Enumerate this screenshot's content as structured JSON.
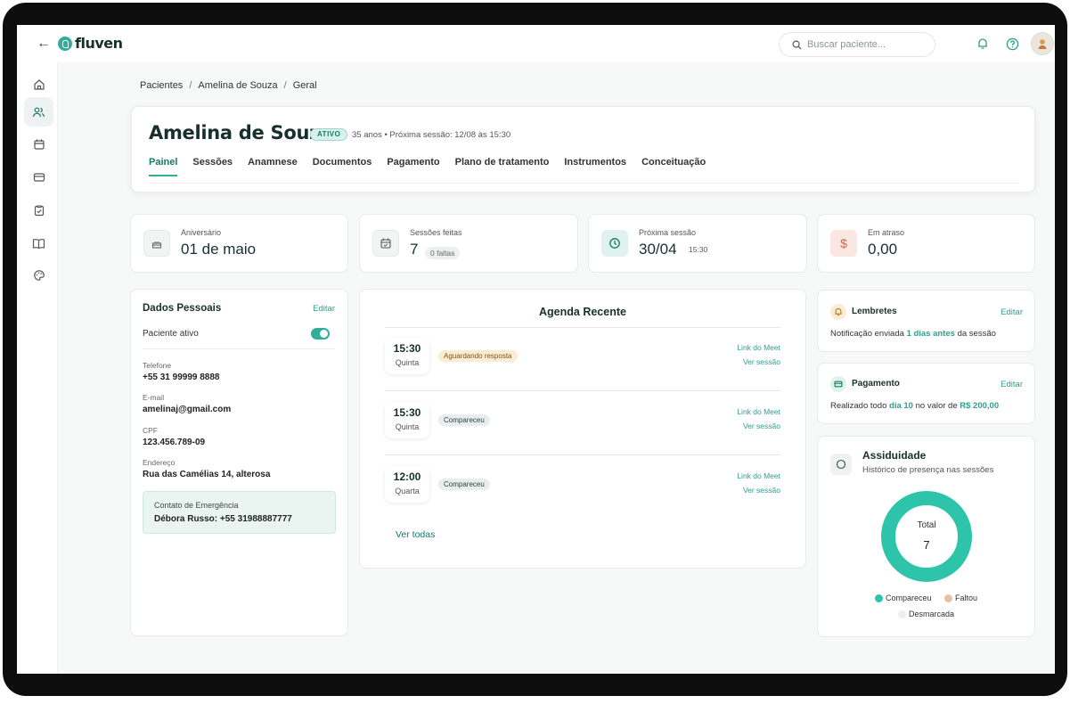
{
  "app": {
    "name": "fluven"
  },
  "search": {
    "placeholder": "Buscar paciente..."
  },
  "breadcrumb": [
    "Pacientes",
    "Amelina de Souza",
    "Geral"
  ],
  "patient": {
    "name": "Amelina de Souza",
    "status": "ATIVO",
    "meta": "35 anos • Próxima sessão: 12/08 às 15:30"
  },
  "tabs": [
    "Painel",
    "Sessões",
    "Anamnese",
    "Documentos",
    "Pagamento",
    "Plano de tratamento",
    "Instrumentos",
    "Conceituação"
  ],
  "stats": {
    "birthday": {
      "label": "Aniversário",
      "value": "01 de maio"
    },
    "sessions": {
      "label": "Sessões feitas",
      "value": "7",
      "chip": "0 faltas"
    },
    "next": {
      "label": "Próxima sessão",
      "value": "30/04",
      "time": "15:30"
    },
    "overdue": {
      "label": "Em atraso",
      "value": "0,00"
    }
  },
  "personal": {
    "title": "Dados Pessoais",
    "edit": "Editar",
    "active_label": "Paciente ativo",
    "phone_label": "Telefone",
    "phone": "+55 31 99999 8888",
    "email_label": "E-mail",
    "email": "amelinaj@gmail.com",
    "cpf_label": "CPF",
    "cpf": "123.456.789-09",
    "address_label": "Endereço",
    "address": "Rua das Camélias 14, alterosa",
    "emergency_label": "Contato de Emergência",
    "emergency": "Débora Russo: +55 31988887777"
  },
  "agenda": {
    "title": "Agenda Recente",
    "items": [
      {
        "time": "15:30",
        "day": "Quinta",
        "status": "Aguardando resposta",
        "link1": "Link do Meet",
        "link2": "Ver sessão"
      },
      {
        "time": "15:30",
        "day": "Quinta",
        "status": "Compareceu",
        "link1": "Link do Meet",
        "link2": "Ver sessão"
      },
      {
        "time": "12:00",
        "day": "Quarta",
        "status": "Compareceu",
        "link1": "Link do Meet",
        "link2": "Ver sessão"
      }
    ],
    "see_all": "Ver todas"
  },
  "reminders": {
    "title": "Lembretes",
    "edit": "Editar",
    "text_before": "Notificação enviada ",
    "highlight": "1 dias antes",
    "text_after": " da sessão"
  },
  "payment": {
    "title": "Pagamento",
    "edit": "Editar",
    "text_before": "Realizado todo ",
    "day": "dia 10",
    "text_mid": " no valor de ",
    "amount": "R$ 200,00"
  },
  "attendance": {
    "title": "Assiduidade",
    "subtitle": "Histórico de presença nas sessões",
    "total_label": "Total",
    "total": "7",
    "legend": [
      {
        "name": "Compareceu",
        "color": "#2ec4aa",
        "value": 7
      },
      {
        "name": "Faltou",
        "color": "#e8c1a0",
        "value": 0
      },
      {
        "name": "Desmarcada",
        "color": "#eeeeee",
        "value": 0
      }
    ]
  },
  "colors": {
    "accent": "#2fae9b",
    "accent_dark": "#157a68",
    "donut": "#2ec4aa"
  }
}
